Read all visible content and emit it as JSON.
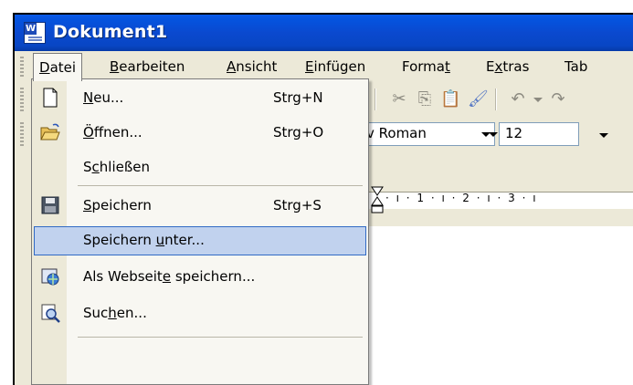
{
  "window": {
    "title": "Dokument1",
    "app_icon": "word-document-icon"
  },
  "menubar": {
    "items": [
      {
        "pre": "",
        "key": "D",
        "post": "atei"
      },
      {
        "pre": "",
        "key": "B",
        "post": "earbeiten"
      },
      {
        "pre": "",
        "key": "A",
        "post": "nsicht"
      },
      {
        "pre": "",
        "key": "E",
        "post": "infügen"
      },
      {
        "pre": "Forma",
        "key": "t",
        "post": ""
      },
      {
        "pre": "E",
        "key": "x",
        "post": "tras"
      },
      {
        "pre": "Tab",
        "key": "",
        "post": ""
      }
    ]
  },
  "formatting": {
    "font": "v Roman",
    "size": "12"
  },
  "ruler": {
    "text": "· ı · 1 · ı · 2 · ı · 3 · ı"
  },
  "file_menu": {
    "items": [
      {
        "pre": "",
        "key": "N",
        "post": "eu...",
        "shortcut": "Strg+N",
        "icon": "new-document-icon"
      },
      {
        "pre": "",
        "key": "Ö",
        "post": "ffnen...",
        "shortcut": "Strg+O",
        "icon": "open-folder-icon"
      },
      {
        "pre": "S",
        "key": "c",
        "post": "hließen",
        "shortcut": "",
        "icon": ""
      },
      {
        "pre": "",
        "key": "S",
        "post": "peichern",
        "shortcut": "Strg+S",
        "icon": "floppy-disk-icon"
      },
      {
        "pre": "Speichern ",
        "key": "u",
        "post": "nter...",
        "shortcut": "",
        "icon": ""
      },
      {
        "pre": "Als Webseit",
        "key": "e",
        "post": " speichern...",
        "shortcut": "",
        "icon": "web-page-icon"
      },
      {
        "pre": "Suc",
        "key": "h",
        "post": "en...",
        "shortcut": "",
        "icon": "search-icon"
      }
    ]
  }
}
